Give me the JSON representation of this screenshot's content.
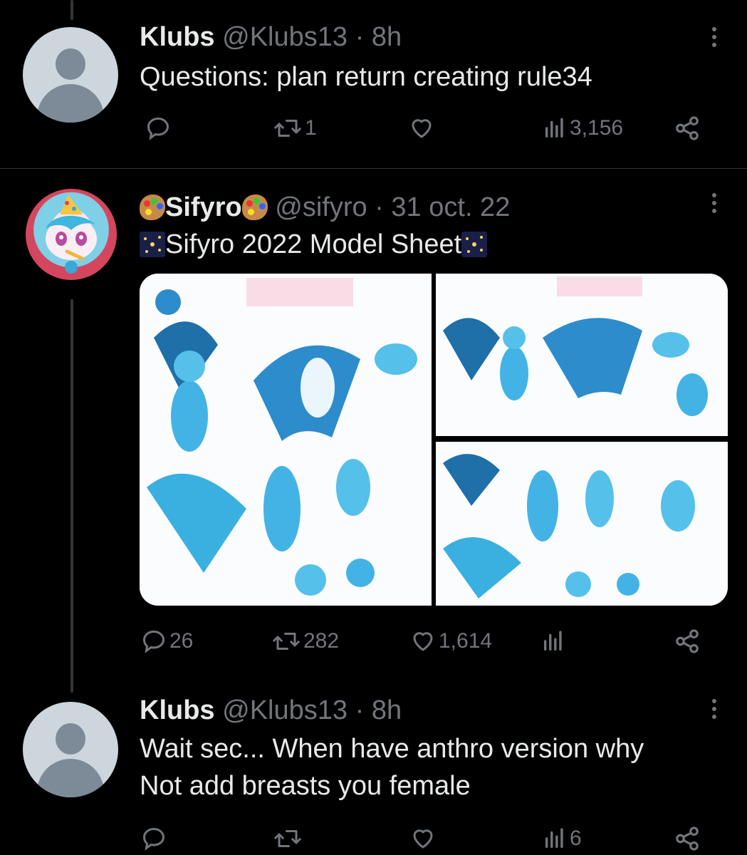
{
  "tweets": [
    {
      "name": "Klubs",
      "handle": "@Klubs13",
      "separator": "·",
      "time": "8h",
      "text": "Questions: plan return creating rule34",
      "avatar_icon": "default-avatar-icon",
      "actions": {
        "reply": "",
        "retweet": "1",
        "like": "",
        "views": "3,156"
      }
    },
    {
      "name": "Sifyro",
      "handle": "@sifyro",
      "separator": "·",
      "time": "31 oct. 22",
      "text": "Sifyro 2022 Model Sheet",
      "name_emoji": "artist-palette-icon",
      "text_emoji": "sparkler-icon",
      "media_icon": "model-sheet-image",
      "actions": {
        "reply": "26",
        "retweet": "282",
        "like": "1,614",
        "views": ""
      }
    },
    {
      "name": "Klubs",
      "handle": "@Klubs13",
      "separator": "·",
      "time": "8h",
      "text_lines": [
        "Wait sec... When have anthro version why",
        "Not add breasts you female"
      ],
      "avatar_icon": "default-avatar-icon",
      "actions": {
        "reply": "",
        "retweet": "",
        "like": "",
        "views": "6"
      }
    }
  ],
  "colors": {
    "background": "#000000",
    "text_primary": "#e7e9ea",
    "text_secondary": "#71767b",
    "divider": "#2f3336",
    "thread_line": "#333639"
  }
}
